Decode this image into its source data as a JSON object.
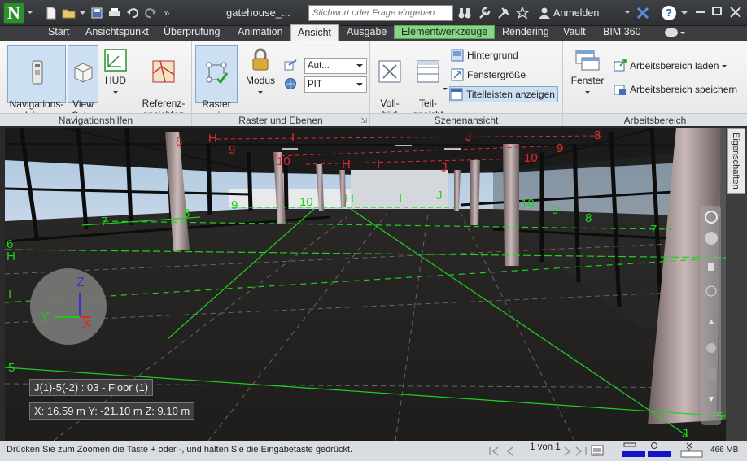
{
  "app": {
    "logo_letter": "N",
    "document_title": "gatehouse_...",
    "search_placeholder": "Stichwort oder Frage eingeben",
    "signin_label": "Anmelden",
    "help_label": "?"
  },
  "tabs": [
    "Start",
    "Ansichtspunkt",
    "Überprüfung",
    "Animation",
    "Ansicht",
    "Ausgabe",
    "Elementwerkzeuge",
    "Rendering",
    "Vault",
    "BIM 360"
  ],
  "active_tab": "Ansicht",
  "context_tab": "Elementwerkzeuge",
  "ribbon": {
    "navigationshilfen": {
      "title": "Navigationshilfen",
      "navigationsleiste": "Navigations-\nleiste",
      "viewcube": "View\nCube",
      "hud": "HUD",
      "referenzansichten": "Referenz-\nansichten"
    },
    "raster": {
      "title": "Raster und Ebenen",
      "raster_anzeigen": "Raster\nanzeigen",
      "modus": "Modus",
      "dropdown_top": "Aut...",
      "dropdown_bottom": "PIT"
    },
    "szenenansicht": {
      "title": "Szenenansicht",
      "vollbild": "Voll-\nbild",
      "teilansicht": "Teil-\nansicht",
      "hintergrund": "Hintergrund",
      "fenstergroesse": "Fenstergröße",
      "titelleisten": "Titelleisten anzeigen"
    },
    "arbeitsbereich": {
      "title": "Arbeitsbereich",
      "fenster": "Fenster",
      "laden": "Arbeitsbereich laden",
      "speichern": "Arbeitsbereich speichern"
    }
  },
  "viewport": {
    "grid_labels": [
      "H",
      "I",
      "J",
      "8",
      "9",
      "10",
      "7",
      "6",
      "H",
      "I",
      "5",
      "J",
      "5",
      "9",
      "10",
      "8",
      "7",
      "I",
      "J",
      "H",
      "9",
      "10"
    ],
    "location_label": "J(1)-5(-2) : 03 - Floor (1)",
    "coordinates": "X: 16.59 m  Y: -21.10 m  Z: 9.10 m",
    "axis_labels": {
      "z": "Z",
      "y": "Y",
      "x": "X"
    }
  },
  "properties_tab": "Eigenschaften",
  "status": {
    "message": "Drücken Sie zum Zoomen die Taste + oder -, und halten Sie die Eingabetaste gedrückt.",
    "pager": "1 von 1",
    "memory": "466 MB"
  },
  "colors": {
    "grid_green": "#1fd11f",
    "grid_red": "#e02a2a",
    "accent_blue": "#7ea7cf"
  }
}
